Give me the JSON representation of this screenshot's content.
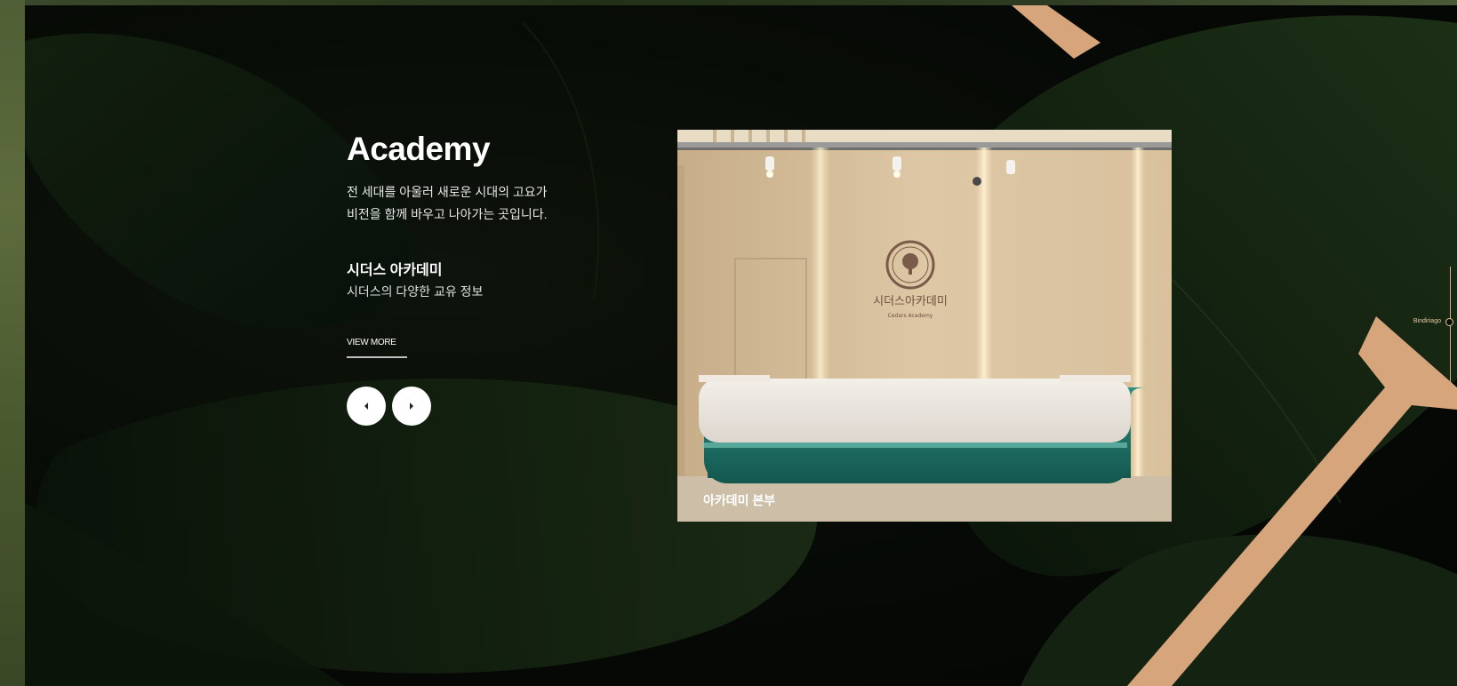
{
  "section": {
    "title": "Academy",
    "description_lines": [
      "전 세대를 아울러 새로운 시대의 고요가",
      "비전을 함께 바우고 나아가는 곳입니다."
    ],
    "subheading": "시더스 아카데미",
    "subdescription": "시더스의 다양한 교유 정보",
    "view_more_label": "VIEW MORE"
  },
  "nav": {
    "prev_icon": "chevron-left-icon",
    "next_icon": "chevron-right-icon"
  },
  "photo": {
    "caption": "아카데미 본부",
    "sign_text": "시더스아카데미",
    "sign_sub": "Cedars Academy"
  },
  "side_nav": {
    "label": "Bindiriago"
  },
  "colors": {
    "accent_tan": "#d7a57c",
    "background": "#070b06",
    "leaf_dark": "#0f1a0d"
  }
}
